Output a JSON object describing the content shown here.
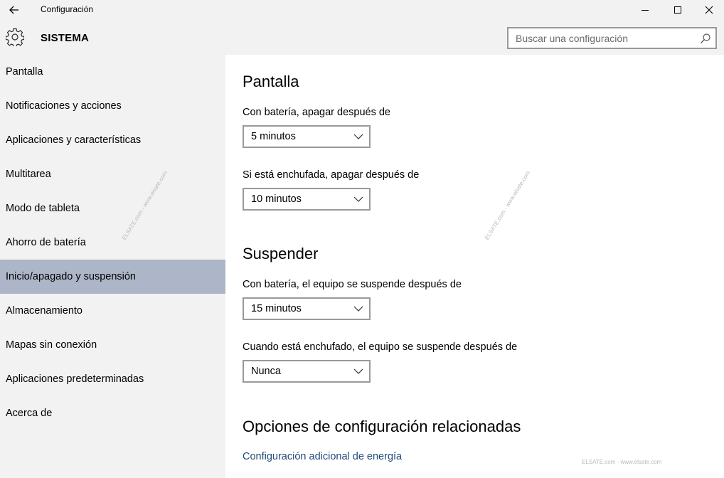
{
  "window": {
    "title": "Configuración",
    "section": "SISTEMA"
  },
  "search": {
    "placeholder": "Buscar una configuración"
  },
  "sidebar": {
    "items": [
      {
        "label": "Pantalla",
        "selected": false
      },
      {
        "label": "Notificaciones y acciones",
        "selected": false
      },
      {
        "label": "Aplicaciones y características",
        "selected": false
      },
      {
        "label": "Multitarea",
        "selected": false
      },
      {
        "label": "Modo de tableta",
        "selected": false
      },
      {
        "label": "Ahorro de batería",
        "selected": false
      },
      {
        "label": "Inicio/apagado y suspensión",
        "selected": true
      },
      {
        "label": "Almacenamiento",
        "selected": false
      },
      {
        "label": "Mapas sin conexión",
        "selected": false
      },
      {
        "label": "Aplicaciones predeterminadas",
        "selected": false
      },
      {
        "label": "Acerca de",
        "selected": false
      }
    ]
  },
  "main": {
    "screen": {
      "heading": "Pantalla",
      "battery_label": "Con batería, apagar después de",
      "battery_value": "5 minutos",
      "plugged_label": "Si está enchufada, apagar después de",
      "plugged_value": "10 minutos"
    },
    "sleep": {
      "heading": "Suspender",
      "battery_label": "Con batería, el equipo se suspende después de",
      "battery_value": "15 minutos",
      "plugged_label": "Cuando está enchufado, el equipo se suspende después de",
      "plugged_value": "Nunca"
    },
    "related": {
      "heading": "Opciones de configuración relacionadas",
      "link": "Configuración adicional de energía"
    }
  },
  "watermark": {
    "text": "ELSATE.com - www.elsate.com"
  },
  "colors": {
    "chrome_bg": "#f2f2f2",
    "selected_bg": "#adb6c8",
    "link": "#1f4a78"
  }
}
